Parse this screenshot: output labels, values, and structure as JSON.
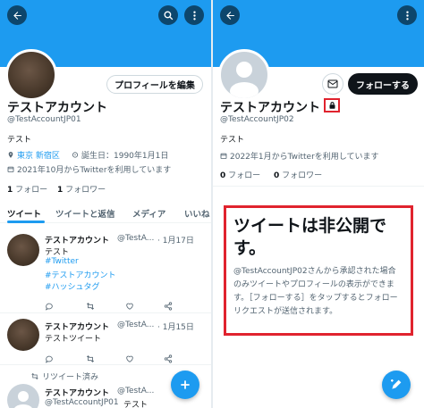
{
  "left": {
    "edit_profile_label": "プロフィールを編集",
    "name": "テストアカウント",
    "handle": "@TestAccountJP01",
    "bio": "テスト",
    "location": "東京 新宿区",
    "birthday": "誕生日：1990年1月1日",
    "joined": "2021年10月からTwitterを利用しています",
    "following_count": "1",
    "following_label": "フォロー",
    "followers_count": "1",
    "followers_label": "フォロワー",
    "tabs": [
      "ツイート",
      "ツイートと返信",
      "メディア",
      "いいね"
    ],
    "tweets": [
      {
        "name": "テストアカウント",
        "handle": "@TestA...",
        "date": "· 1月17日",
        "lines": [
          "テスト"
        ],
        "tags": [
          "#Twitter",
          "#テストアカウント",
          "#ハッシュタグ"
        ]
      },
      {
        "name": "テストアカウント",
        "handle": "@TestA...",
        "date": "· 1月15日",
        "lines": [
          "テストツイート"
        ],
        "tags": []
      }
    ],
    "retweeted_label": "リツイート済み",
    "retweet": {
      "name": "テストアカウント",
      "handle": "@TestA...",
      "date": "1月15日",
      "sub_handle": "@TestAccountJP01",
      "text": "テスト"
    }
  },
  "right": {
    "follow_label": "フォローする",
    "name": "テストアカウント",
    "handle": "@TestAccountJP02",
    "bio": "テスト",
    "joined": "2022年1月からTwitterを利用しています",
    "following_count": "0",
    "following_label": "フォロー",
    "followers_count": "0",
    "followers_label": "フォロワー",
    "private_title": "ツイートは非公開です。",
    "private_desc": "@TestAccountJP02さんから承認された場合のみツイートやプロフィールの表示ができます。［フォローする］をタップするとフォローリクエストが送信されます。"
  },
  "colors": {
    "accent": "#1d9bf0",
    "highlight": "#e0232e"
  },
  "icons": [
    "back-arrow-icon",
    "search-icon",
    "more-icon",
    "location-icon",
    "birthday-icon",
    "calendar-icon",
    "reply-icon",
    "retweet-icon",
    "like-icon",
    "share-icon",
    "compose-icon",
    "mail-icon",
    "lock-icon"
  ]
}
